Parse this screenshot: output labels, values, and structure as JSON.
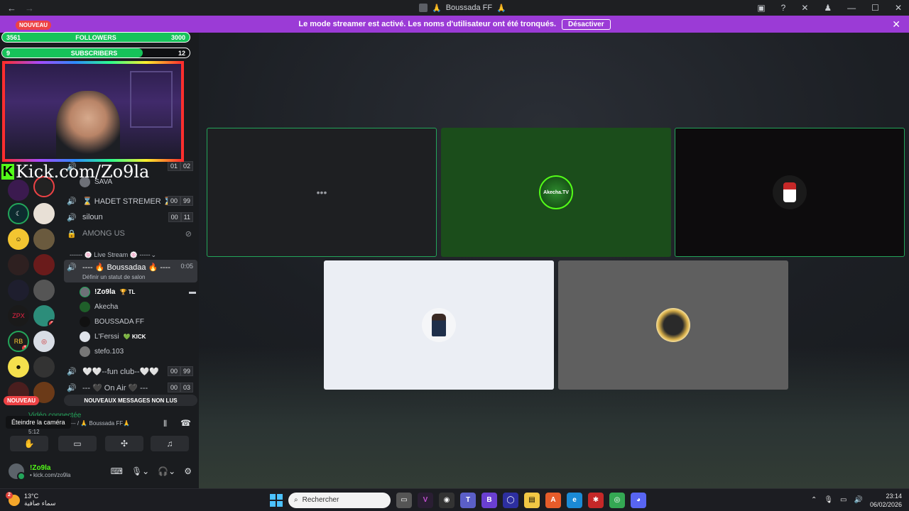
{
  "titlebar": {
    "title": "Boussada FF",
    "title_emoji": "🙏"
  },
  "banner": {
    "text": "Le mode streamer est activé. Les noms d'utilisateur ont été tronqués.",
    "button": "Désactiver"
  },
  "overlay": {
    "followers_label": "FOLLOWERS",
    "followers_current": "3561",
    "followers_goal": "3000",
    "subs_label": "SUBSCRIBERS",
    "subs_current": "9",
    "subs_goal": "12",
    "subs_progress": 0.75,
    "kick_text": "Kick.com/Zo9la",
    "nouveau_top": "NOUVEAU"
  },
  "channels": [
    {
      "name": "SAVA",
      "icon": "speaker-icon"
    },
    {
      "name": "⌛ HADET STREMER ⌛",
      "icon": "speaker-icon",
      "a": "00",
      "b": "99"
    },
    {
      "name": "siloun",
      "icon": "speaker-icon",
      "a": "00",
      "b": "11"
    },
    {
      "name": "AMONG US",
      "icon": "lock-icon"
    }
  ],
  "first_channel_counts": {
    "a": "01",
    "b": "02"
  },
  "category": "------ 🍥 Live Stream 🍥 ------",
  "active_channel": {
    "name": "---- 🔥 Boussadaa 🔥 ----",
    "time": "0:05",
    "status": "Définir un statut de salon"
  },
  "voice_users": [
    {
      "name": "!Zo9la",
      "tag": "🏆 TL"
    },
    {
      "name": "Akecha",
      "tag": ""
    },
    {
      "name": "BOUSSADA FF",
      "tag": ""
    },
    {
      "name": "L'Ferssi",
      "tag": "💚 KICK"
    },
    {
      "name": "stefo.103",
      "tag": ""
    }
  ],
  "more_channels": [
    {
      "name": "🤍🤍--fun club--🤍🤍",
      "a": "00",
      "b": "99"
    },
    {
      "name": "--- 🖤 On Air 🖤 ---",
      "a": "00",
      "b": "03"
    }
  ],
  "unread_banner": "NOUVEAUX MESSAGES NON LUS",
  "nouveau_bottom": "NOUVEAU",
  "voice_panel": {
    "connected": "Vidéo connectée",
    "tooltip": "Éteindre la caméra",
    "channel": "---- / 🙏 Boussada FF🙏",
    "time": "5:12"
  },
  "user": {
    "name": "!Zo9la",
    "status": "• kick.com/zo9la"
  },
  "guild_badges": [
    "23",
    "3",
    "1"
  ],
  "tiles": [
    {
      "label": "•••"
    },
    {
      "label": "Akecha.TV"
    },
    {
      "label": ""
    },
    {
      "label": ""
    },
    {
      "label": ""
    }
  ],
  "taskbar": {
    "temp": "13°C",
    "weather_desc": "سماء صافية",
    "weather_badge": "2",
    "search_placeholder": "Rechercher",
    "time": "23:14",
    "date": "06/02/2026"
  }
}
